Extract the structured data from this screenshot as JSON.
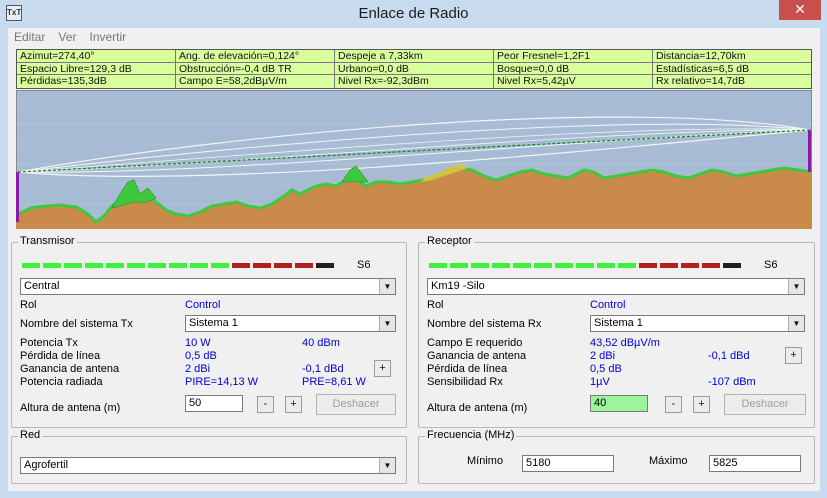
{
  "window": {
    "title": "Enlace de Radio",
    "icon_text": "TxT",
    "close_glyph": "✕"
  },
  "menu": [
    {
      "label": "Editar"
    },
    {
      "label": "Ver"
    },
    {
      "label": "Invertir"
    }
  ],
  "info_table": [
    [
      "Azimut=274,40°",
      "Ang. de elevación=0,124°",
      "Despeje a 7,33km",
      "Peor Fresnel=1,2F1",
      "Distancia=12,70km"
    ],
    [
      "Espacio Libre=129,3 dB",
      "Obstrucción=-0,4 dB TR",
      "Urbano=0,0 dB",
      "Bosque=0,0 dB",
      "Estadísticas=6,5 dB"
    ],
    [
      "Pérdidas=135,3dB",
      "Campo E=58,2dBµV/m",
      "Nivel Rx=-92,3dBm",
      "Nivel Rx=5,42µV",
      "Rx relativo=14,7dB"
    ]
  ],
  "colors": {
    "info_bg": "#d8ff9c",
    "sky": "#a7bbd4",
    "terrain": "#c98a4a",
    "vegetation": "#3ec83e",
    "tower": "#8b1aa8"
  },
  "transmitter": {
    "title": "Transmisor",
    "signal_label": "S6",
    "signal_segments": [
      "#3cf03c",
      "#3cf03c",
      "#3cf03c",
      "#3cf03c",
      "#3cf03c",
      "#3cf03c",
      "#3cf03c",
      "#3cf03c",
      "#3cf03c",
      "#3cf03c",
      "#b02020",
      "#b02020",
      "#b02020",
      "#b02020",
      "#202020"
    ],
    "station": "Central",
    "rol_label": "Rol",
    "rol_value": "Control",
    "system_label": "Nombre del sistema Tx",
    "system_value": "Sistema  1",
    "power_label": "Potencia Tx",
    "power_w": "10 W",
    "power_dbm": "40 dBm",
    "line_loss_label": "Pérdida de línea",
    "line_loss": "0,5 dB",
    "gain_label": "Ganancia de antena",
    "gain_dbi": "2 dBi",
    "gain_dbd": "-0,1 dBd",
    "radiated_label": "Potencia radiada",
    "pire": "PIRE=14,13 W",
    "pre": "PRE=8,61 W",
    "height_label": "Altura de antena (m)",
    "height_value": "50",
    "minus": "-",
    "plus": "+",
    "undo": "Deshacer"
  },
  "receiver": {
    "title": "Receptor",
    "signal_label": "S6",
    "signal_segments": [
      "#3cf03c",
      "#3cf03c",
      "#3cf03c",
      "#3cf03c",
      "#3cf03c",
      "#3cf03c",
      "#3cf03c",
      "#3cf03c",
      "#3cf03c",
      "#3cf03c",
      "#b02020",
      "#b02020",
      "#b02020",
      "#b02020",
      "#202020"
    ],
    "station": "Km19 -Silo",
    "rol_label": "Rol",
    "rol_value": "Control",
    "system_label": "Nombre del sistema Rx",
    "system_value": "Sistema  1",
    "field_label": "Campo E requerido",
    "field_value": "43,52 dBµV/m",
    "gain_label": "Ganancia de antena",
    "gain_dbi": "2 dBi",
    "gain_dbd": "-0,1 dBd",
    "line_loss_label": "Pérdida de línea",
    "line_loss": "0,5 dB",
    "sensitivity_label": "Sensibilidad Rx",
    "sensitivity_uv": "1µV",
    "sensitivity_dbm": "-107 dBm",
    "height_label": "Altura de antena (m)",
    "height_value": "40",
    "minus": "-",
    "plus": "+",
    "undo": "Deshacer"
  },
  "network": {
    "title": "Red",
    "value": "Agrofertil"
  },
  "frequency": {
    "title": "Frecuencia (MHz)",
    "min_label": "Mínimo",
    "min_value": "5180",
    "max_label": "Máximo",
    "max_value": "5825"
  }
}
